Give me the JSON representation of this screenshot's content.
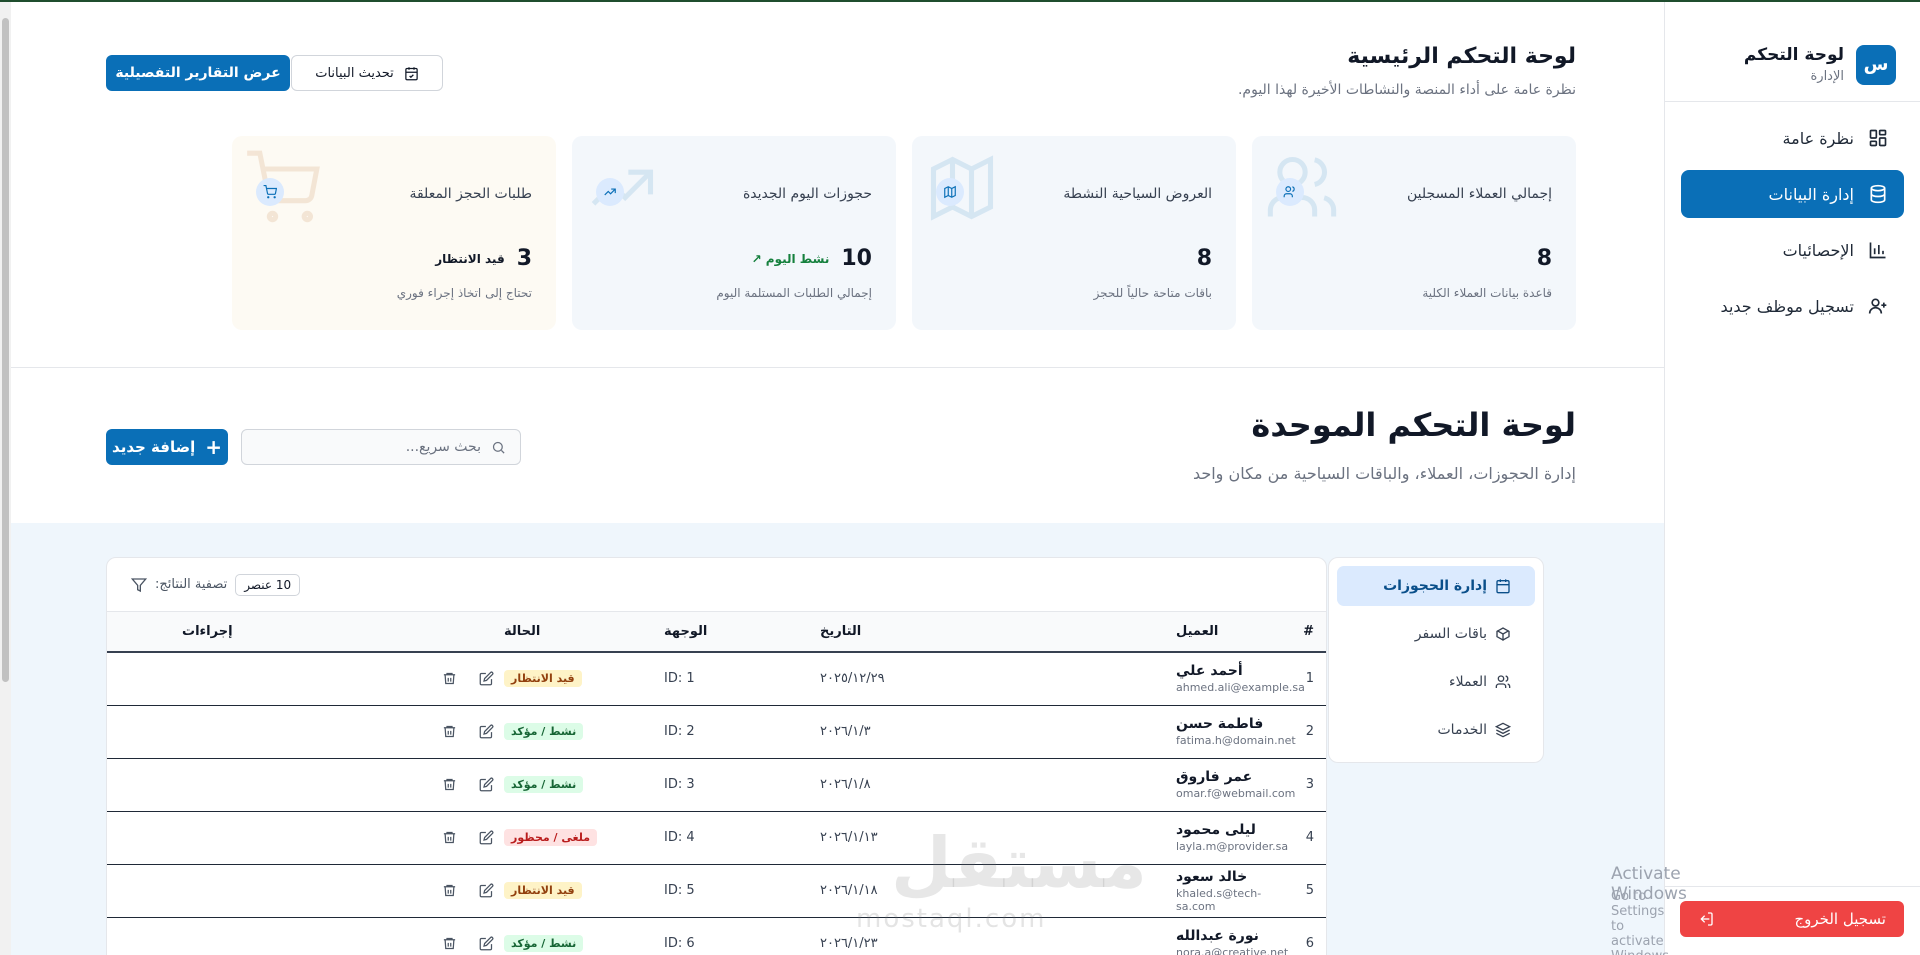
{
  "brand": {
    "logo": "س",
    "title": "لوحة التحكم",
    "subtitle": "الإدارة"
  },
  "nav": [
    {
      "label": "نظرة عامة",
      "icon": "grid-icon",
      "active": false
    },
    {
      "label": "إدارة البيانات",
      "icon": "database-icon",
      "active": true
    },
    {
      "label": "الإحصائيات",
      "icon": "bar-chart-icon",
      "active": false
    },
    {
      "label": "تسجيل موظف جديد",
      "icon": "user-plus-icon",
      "active": false
    }
  ],
  "logout": {
    "label": "تسجيل الخروج"
  },
  "header": {
    "title": "لوحة التحكم الرئيسية",
    "subtitle": "نظرة عامة على أداء المنصة والنشاطات الأخيرة لهذا اليوم.",
    "primary_button": "عرض التقارير التفصيلية",
    "refresh_button": "تحديث البيانات"
  },
  "cards": [
    {
      "label": "إجمالي العملاء المسجلين",
      "value": "8",
      "tag": "",
      "note": "قاعدة بيانات العملاء الكلية",
      "icon": "users-icon"
    },
    {
      "label": "العروض السياحية النشطة",
      "value": "8",
      "tag": "",
      "note": "باقات متاحة حالياً للحجز",
      "icon": "map-icon"
    },
    {
      "label": "حجوزات اليوم الجديدة",
      "value": "10",
      "tag": "نشط اليوم ↗",
      "note": "إجمالي الطلبات المستلمة اليوم",
      "icon": "trending-up-icon"
    },
    {
      "label": "طلبات الحجز المعلقة",
      "value": "3",
      "tag": "قيد الانتظار",
      "note": "تحتاج إلى اتخاذ إجراء فوري",
      "icon": "cart-icon"
    }
  ],
  "section": {
    "title": "لوحة التحكم الموحدة",
    "subtitle": "إدارة الحجوزات، العملاء، والباقات السياحية من مكان واحد",
    "add_button": "إضافة جديد",
    "search_placeholder": "بحث سريع..."
  },
  "tabs": [
    {
      "label": "إدارة الحجوزات",
      "icon": "calendar-icon",
      "active": true
    },
    {
      "label": "باقات السفر",
      "icon": "package-icon",
      "active": false
    },
    {
      "label": "العملاء",
      "icon": "users-icon",
      "active": false
    },
    {
      "label": "الخدمات",
      "icon": "layers-icon",
      "active": false
    }
  ],
  "table": {
    "count": "10 عنصر",
    "filter_label": "تصفية النتائج:",
    "columns": [
      "#",
      "العميل",
      "التاريخ",
      "الوجهة",
      "الحالة",
      "إجراءات"
    ],
    "rows": [
      {
        "num": "1",
        "name": "أحمد علي",
        "email": "ahmed.ali@example.sa",
        "date": "٢٠٢٥/١٢/٢٩",
        "dest": "ID: 1",
        "status": "قيد الانتظار",
        "status_kind": "pending"
      },
      {
        "num": "2",
        "name": "فاطمة حسن",
        "email": "fatima.h@domain.net",
        "date": "٢٠٢٦/١/٣",
        "dest": "ID: 2",
        "status": "نشط / مؤكد",
        "status_kind": "active"
      },
      {
        "num": "3",
        "name": "عمر فاروق",
        "email": "omar.f@webmail.com",
        "date": "٢٠٢٦/١/٨",
        "dest": "ID: 3",
        "status": "نشط / مؤكد",
        "status_kind": "active"
      },
      {
        "num": "4",
        "name": "ليلى محمود",
        "email": "layla.m@provider.sa",
        "date": "٢٠٢٦/١/١٣",
        "dest": "ID: 4",
        "status": "ملغى / محظور",
        "status_kind": "cancel"
      },
      {
        "num": "5",
        "name": "خالد سعود",
        "email": "khaled.s@tech-sa.com",
        "date": "٢٠٢٦/١/١٨",
        "dest": "ID: 5",
        "status": "قيد الانتظار",
        "status_kind": "pending"
      },
      {
        "num": "6",
        "name": "نورة عبدالله",
        "email": "nora.a@creative.net",
        "date": "٢٠٢٦/١/٢٣",
        "dest": "ID: 6",
        "status": "نشط / مؤكد",
        "status_kind": "active"
      }
    ]
  },
  "watermark": {
    "arabic": "مستقل",
    "latin": "mostaql.com"
  },
  "windows": {
    "line1": "Activate Windows",
    "line2": "Go to Settings to activate Windows."
  }
}
